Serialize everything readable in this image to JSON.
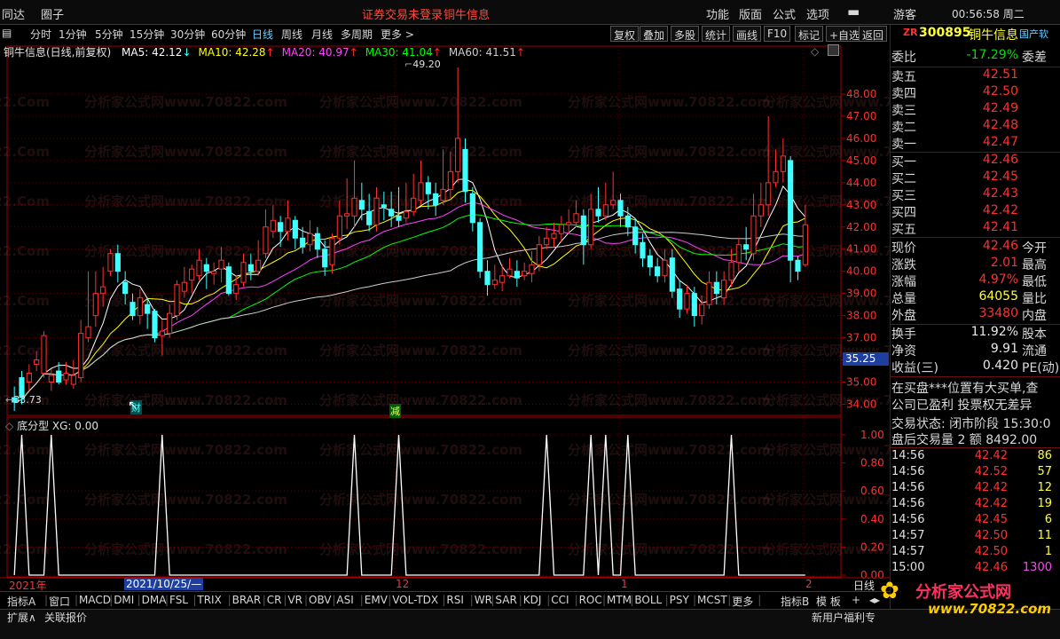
{
  "menubar": {
    "left": [
      "同达",
      "圈子"
    ],
    "status_left": "证券交易未登录",
    "status_right": "铜牛信息",
    "right": [
      "功能",
      "版面",
      "公式",
      "选项"
    ],
    "guest": "游客",
    "clock": "00:56:58 周二"
  },
  "toolbar": {
    "periods": [
      "分时",
      "1分钟",
      "5分钟",
      "15分钟",
      "30分钟",
      "60分钟",
      "日线",
      "周线",
      "月线",
      "多周期",
      "更多 >"
    ],
    "buttons": [
      "复权",
      "叠加",
      "多股",
      "统计",
      "画线",
      "F10",
      "标记",
      "+自选",
      "返回"
    ]
  },
  "main_chart": {
    "title": "铜牛信息(日线,前复权)",
    "ma_labels": [
      {
        "text": "MA5: 42.12",
        "color": "#ffffff",
        "arrow": "↓"
      },
      {
        "text": "MA10: 42.28",
        "color": "#ffff00",
        "arrow": "↑"
      },
      {
        "text": "MA20: 40.97",
        "color": "#ff44ff",
        "arrow": "↑"
      },
      {
        "text": "MA30: 41.04",
        "color": "#00ff00",
        "arrow": "↑"
      },
      {
        "text": "MA60: 41.51",
        "color": "#cccccc",
        "arrow": "↑"
      }
    ],
    "ylim": [
      33.5,
      49.6
    ],
    "y_ticks": [
      34,
      35,
      36,
      37,
      38,
      39,
      40,
      41,
      42,
      43,
      44,
      45,
      46,
      47,
      48
    ],
    "high_label": "49.20",
    "low_label": "33.73",
    "price_marker": "35.25",
    "event_markers": [
      "财",
      "减"
    ],
    "colors": {
      "up": "#ff3030",
      "down": "#40ffff",
      "grid": "#5a0000",
      "axis": "#a00000"
    }
  },
  "indicator": {
    "title": "底分型",
    "value_label": "XG: 0.00",
    "y_ticks": [
      0.0,
      0.2,
      0.4,
      0.6,
      0.8,
      1.0
    ],
    "y_tick_labels": [
      "0.00",
      "0.20",
      "0.40",
      "0.60",
      "0.80",
      "1.00"
    ],
    "signal_bars": [
      1,
      5,
      20,
      46,
      52,
      72,
      78,
      80,
      83,
      97
    ]
  },
  "timeaxis": {
    "year_label": "2021年",
    "cursor_date": "2021/10/25/—",
    "month_labels": [
      "12",
      "1",
      "2"
    ],
    "right_label": "日线"
  },
  "chart_data": {
    "type": "candlestick",
    "ylim": [
      33.5,
      49.6
    ],
    "candles": [
      [
        34.3,
        34.1,
        34.8,
        33.7
      ],
      [
        35.2,
        34.3,
        35.5,
        34.0
      ],
      [
        35.0,
        35.4,
        35.8,
        34.6
      ],
      [
        35.8,
        36.0,
        36.4,
        35.5
      ],
      [
        35.4,
        37.1,
        37.3,
        35.2
      ],
      [
        35.0,
        35.3,
        35.6,
        34.6
      ],
      [
        35.5,
        35.0,
        35.9,
        34.9
      ],
      [
        35.1,
        35.4,
        35.9,
        34.9
      ],
      [
        34.9,
        35.3,
        36.0,
        34.7
      ],
      [
        35.2,
        37.2,
        37.8,
        35.0
      ],
      [
        37.0,
        37.5,
        40.0,
        36.8
      ],
      [
        38.0,
        39.0,
        40.0,
        37.5
      ],
      [
        39.0,
        39.3,
        40.2,
        38.4
      ],
      [
        40.0,
        40.8,
        41.0,
        39.8
      ],
      [
        40.8,
        40.0,
        41.2,
        39.5
      ],
      [
        39.5,
        39.0,
        40.0,
        38.5
      ],
      [
        38.6,
        38.0,
        39.0,
        37.8
      ],
      [
        38.0,
        38.8,
        39.2,
        37.6
      ],
      [
        38.5,
        38.1,
        38.8,
        37.4
      ],
      [
        38.2,
        37.0,
        38.3,
        36.8
      ],
      [
        37.1,
        37.3,
        37.8,
        36.2
      ],
      [
        37.2,
        38.1,
        38.5,
        37.0
      ],
      [
        38.0,
        39.4,
        39.6,
        37.8
      ],
      [
        39.1,
        39.5,
        40.2,
        38.8
      ],
      [
        39.6,
        40.1,
        40.3,
        39.0
      ],
      [
        39.8,
        40.5,
        41.0,
        39.6
      ],
      [
        40.3,
        40.0,
        40.6,
        39.2
      ],
      [
        39.9,
        40.0,
        40.4,
        39.4
      ],
      [
        40.1,
        40.5,
        41.1,
        39.5
      ],
      [
        40.2,
        39.0,
        40.4,
        38.9
      ],
      [
        39.0,
        39.4,
        39.8,
        38.7
      ],
      [
        39.5,
        40.4,
        40.8,
        39.3
      ],
      [
        40.3,
        40.0,
        40.8,
        39.6
      ],
      [
        40.0,
        40.5,
        41.4,
        39.8
      ],
      [
        40.8,
        42.0,
        42.8,
        40.6
      ],
      [
        41.8,
        42.3,
        43.0,
        41.5
      ],
      [
        42.2,
        41.8,
        42.5,
        41.1
      ],
      [
        41.8,
        42.4,
        43.2,
        41.4
      ],
      [
        42.3,
        41.5,
        42.5,
        41.0
      ],
      [
        41.5,
        41.1,
        42.0,
        40.8
      ],
      [
        41.2,
        41.7,
        42.3,
        40.9
      ],
      [
        41.7,
        41.0,
        42.0,
        40.6
      ],
      [
        41.0,
        40.2,
        41.4,
        39.8
      ],
      [
        40.3,
        41.5,
        41.7,
        39.9
      ],
      [
        41.5,
        42.5,
        43.2,
        41.2
      ],
      [
        42.5,
        42.6,
        44.2,
        41.9
      ],
      [
        42.5,
        43.3,
        45.0,
        42.0
      ],
      [
        43.2,
        42.8,
        44.0,
        42.3
      ],
      [
        42.7,
        42.1,
        43.5,
        41.8
      ],
      [
        42.1,
        43.3,
        43.8,
        41.8
      ],
      [
        43.0,
        42.9,
        43.6,
        42.3
      ],
      [
        42.8,
        42.5,
        43.6,
        42.0
      ],
      [
        42.5,
        42.3,
        43.8,
        42.0
      ],
      [
        42.4,
        42.7,
        44.0,
        42.2
      ],
      [
        42.7,
        43.3,
        44.4,
        42.5
      ],
      [
        43.2,
        44.0,
        45.0,
        43.0
      ],
      [
        44.0,
        43.5,
        44.3,
        42.8
      ],
      [
        43.5,
        43.0,
        44.0,
        42.5
      ],
      [
        43.2,
        43.7,
        45.5,
        43.0
      ],
      [
        43.7,
        44.5,
        45.4,
        43.3
      ],
      [
        44.5,
        46.0,
        49.2,
        44.0
      ],
      [
        45.5,
        43.6,
        46.0,
        43.1
      ],
      [
        43.5,
        42.2,
        43.8,
        41.8
      ],
      [
        42.2,
        40.0,
        42.4,
        39.7
      ],
      [
        40.0,
        39.4,
        40.5,
        38.9
      ],
      [
        39.4,
        39.6,
        40.3,
        39.2
      ],
      [
        39.5,
        39.8,
        40.3,
        39.1
      ],
      [
        39.8,
        40.1,
        40.6,
        39.7
      ],
      [
        40.0,
        39.7,
        40.5,
        39.3
      ],
      [
        39.8,
        40.0,
        40.4,
        39.6
      ],
      [
        39.9,
        40.3,
        40.9,
        39.5
      ],
      [
        40.3,
        41.2,
        41.6,
        40.0
      ],
      [
        41.2,
        41.5,
        42.0,
        41.0
      ],
      [
        41.5,
        41.7,
        42.2,
        41.1
      ],
      [
        41.7,
        42.1,
        42.5,
        41.3
      ],
      [
        42.1,
        42.2,
        42.8,
        41.7
      ],
      [
        42.2,
        42.6,
        43.2,
        42.0
      ],
      [
        42.5,
        41.2,
        42.8,
        40.3
      ],
      [
        41.2,
        42.8,
        43.5,
        41.0
      ],
      [
        42.8,
        42.5,
        43.8,
        42.2
      ],
      [
        42.5,
        43.0,
        44.0,
        42.3
      ],
      [
        43.0,
        43.2,
        44.5,
        42.8
      ],
      [
        43.2,
        42.5,
        43.5,
        42.0
      ],
      [
        42.5,
        42.0,
        42.9,
        41.6
      ],
      [
        42.0,
        41.2,
        42.4,
        40.8
      ],
      [
        41.3,
        40.6,
        41.7,
        40.2
      ],
      [
        40.7,
        40.2,
        41.0,
        39.8
      ],
      [
        40.2,
        39.8,
        40.6,
        39.5
      ],
      [
        39.8,
        40.5,
        41.0,
        39.5
      ],
      [
        40.6,
        39.1,
        41.0,
        38.8
      ],
      [
        39.2,
        38.3,
        39.6,
        37.9
      ],
      [
        38.3,
        39.0,
        39.4,
        38.1
      ],
      [
        39.0,
        38.0,
        39.3,
        37.5
      ],
      [
        38.0,
        38.5,
        38.9,
        37.6
      ],
      [
        38.5,
        39.5,
        40.0,
        38.3
      ],
      [
        39.5,
        39.0,
        40.0,
        38.5
      ],
      [
        38.8,
        39.6,
        40.0,
        38.5
      ],
      [
        39.6,
        40.4,
        41.0,
        39.3
      ],
      [
        40.4,
        41.2,
        41.5,
        40.0
      ],
      [
        41.2,
        41.0,
        42.0,
        40.5
      ],
      [
        40.8,
        42.5,
        43.5,
        40.5
      ],
      [
        42.5,
        43.0,
        44.0,
        42.0
      ],
      [
        43.0,
        44.0,
        47.0,
        42.5
      ],
      [
        44.0,
        44.5,
        45.5,
        43.8
      ],
      [
        44.5,
        45.2,
        46.0,
        44.0
      ],
      [
        45.0,
        40.5,
        45.2,
        39.5
      ],
      [
        40.5,
        40.0,
        40.7,
        39.6
      ],
      [
        40.3,
        42.1,
        43.0,
        40.2
      ]
    ],
    "ma_values": {
      "MA5": 42.12,
      "MA10": 42.28,
      "MA20": 40.97,
      "MA30": 41.04,
      "MA60": 41.51
    }
  },
  "right_panel": {
    "stock_code_prefix": "ZR",
    "stock_code": "300895",
    "stock_name": "铜牛信息",
    "tag": "国产软",
    "webi": {
      "label": "委比",
      "value": "-17.29%",
      "label2": "委差"
    },
    "asks": [
      {
        "label": "卖五",
        "price": "42.51"
      },
      {
        "label": "卖四",
        "price": "42.50"
      },
      {
        "label": "卖三",
        "price": "42.49"
      },
      {
        "label": "卖二",
        "price": "42.48"
      },
      {
        "label": "卖一",
        "price": "42.47"
      }
    ],
    "bids": [
      {
        "label": "买一",
        "price": "42.46"
      },
      {
        "label": "买二",
        "price": "42.45"
      },
      {
        "label": "买三",
        "price": "42.43"
      },
      {
        "label": "买四",
        "price": "42.42"
      },
      {
        "label": "买五",
        "price": "42.41"
      }
    ],
    "stats": [
      {
        "label": "现价",
        "value": "42.46",
        "label2": "今开",
        "color": "red"
      },
      {
        "label": "涨跌",
        "value": "2.01",
        "label2": "最高",
        "color": "red"
      },
      {
        "label": "涨幅",
        "value": "4.97%",
        "label2": "最低",
        "color": "red"
      },
      {
        "label": "总量",
        "value": "64055",
        "label2": "量比",
        "color": "yel"
      },
      {
        "label": "外盘",
        "value": "33480",
        "label2": "内盘",
        "color": "red"
      }
    ],
    "stats2": [
      {
        "label": "换手",
        "value": "11.92%",
        "label2": "股本",
        "color": "wht"
      },
      {
        "label": "净资",
        "value": "9.91",
        "label2": "流通",
        "color": "wht"
      },
      {
        "label": "收益(三)",
        "value": "0.420",
        "label2": "PE(动)",
        "color": "wht"
      }
    ],
    "notes": [
      "在买盘***位置有大买单,查",
      "公司已盈利 投票权无差异"
    ],
    "trade_status": "交易状态: 闭市阶段 15:30:0",
    "after_hours": "盘后交易量 2 额 8492.00",
    "ticks": [
      {
        "time": "14:56",
        "price": "42.42",
        "vol": "86"
      },
      {
        "time": "14:56",
        "price": "42.52",
        "vol": "57"
      },
      {
        "time": "14:56",
        "price": "42.42",
        "vol": "12"
      },
      {
        "time": "14:56",
        "price": "42.42",
        "vol": "19"
      },
      {
        "time": "14:56",
        "price": "42.45",
        "vol": "6"
      },
      {
        "time": "14:57",
        "price": "42.50",
        "vol": "11"
      },
      {
        "time": "14:57",
        "price": "42.50",
        "vol": "1"
      },
      {
        "time": "15:00",
        "price": "42.46",
        "vol": "1300"
      }
    ]
  },
  "tabs": {
    "items": [
      "指标A",
      "窗口",
      "MACD",
      "DMI",
      "DMA",
      "FSL",
      "TRIX",
      "BRAR",
      "CR",
      "VR",
      "OBV",
      "ASI",
      "EMV",
      "VOL-TDX",
      "RSI",
      "WR",
      "SAR",
      "KDJ",
      "CCI",
      "ROC",
      "MTM",
      "BOLL",
      "PSY",
      "MCST",
      "更多"
    ],
    "right": [
      "指标B",
      "模 板"
    ]
  },
  "bottom": {
    "items": [
      "扩展∧",
      "关联报价"
    ],
    "right_text": "新用户福利专",
    "logo_text": "分析家公式网",
    "logo_url": "www.70822.com"
  },
  "watermark": {
    "text": "分析家公式网www.70822.com",
    "short": "822.Com"
  }
}
